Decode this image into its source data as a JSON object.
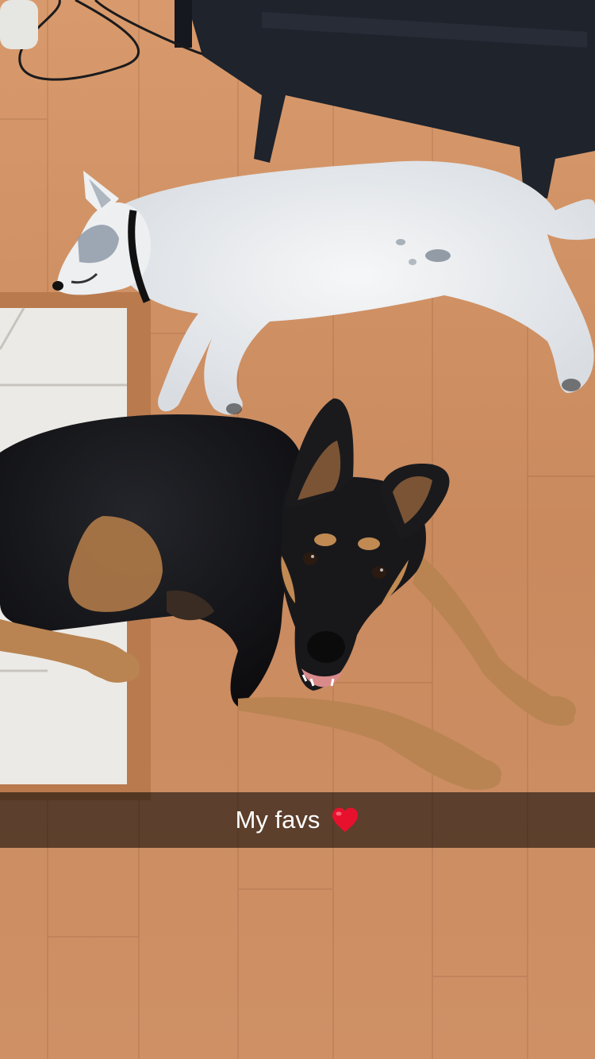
{
  "caption": {
    "text": "My favs",
    "emoji": "red-heart-icon",
    "emoji_color": "#e8112d"
  },
  "colors": {
    "floor": "#c98a5e",
    "tile": "#eceae6",
    "chair": "#1e232c",
    "white_dog": "#eef0f2",
    "black_dog": "#141416",
    "tan": "#b98451",
    "caption_bar": "rgba(0,0,0,0.55)"
  }
}
